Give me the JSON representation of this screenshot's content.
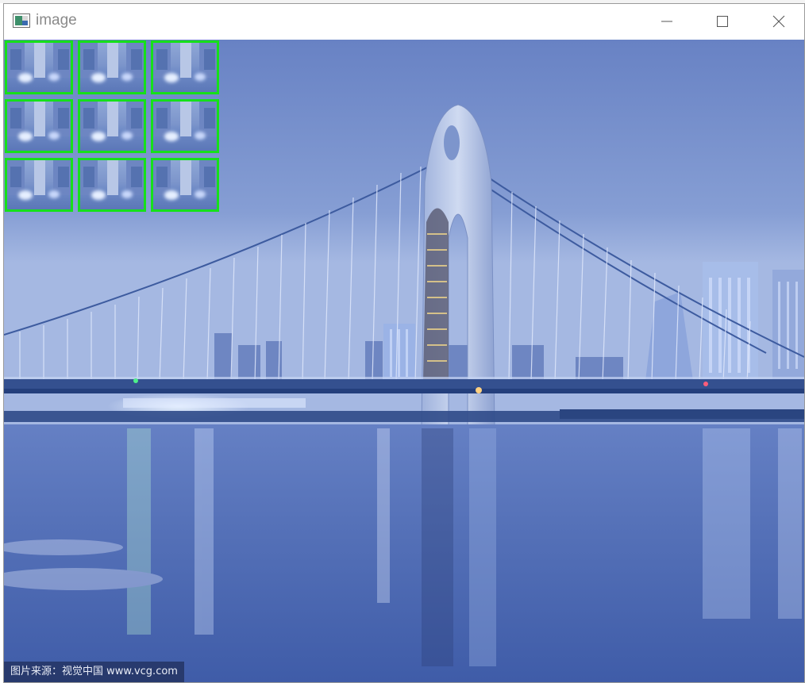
{
  "window": {
    "title": "image",
    "controls": {
      "minimize": "minimize",
      "maximize": "maximize",
      "close": "close"
    }
  },
  "image": {
    "watermark": "图片来源：视觉中国 www.vcg.com",
    "thumbnail_grid": {
      "rows": 3,
      "cols": 3,
      "border_color": "#16e01a"
    }
  },
  "colors": {
    "sky_top": "#6b86c6",
    "sky_bottom": "#a9bde3",
    "water": "#4f6cb3",
    "grid_border": "#16e01a"
  }
}
